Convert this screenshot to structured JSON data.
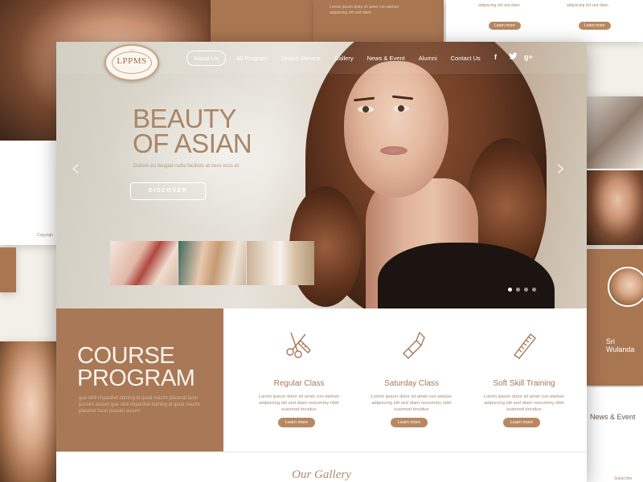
{
  "colors": {
    "accent": "#a97856",
    "button": "#b88862",
    "text_brown": "#a4795a"
  },
  "logo": {
    "text": "LPPMS"
  },
  "nav": {
    "items": [
      "About Us",
      "All Program",
      "Online Service",
      "Gallery",
      "News & Event",
      "Alumni",
      "Contact Us"
    ],
    "active": "About Us",
    "social": [
      "facebook-icon",
      "twitter-icon",
      "google-plus-icon"
    ]
  },
  "hero": {
    "title_line1": "BEAUTY",
    "title_line2": "OF ASIAN",
    "subtitle": "Dolore eu feugiat nulla facilisis at vero eros et",
    "cta": "DISCOVER",
    "slide_count": 4,
    "active_slide": 1
  },
  "course": {
    "title_line1": "COURSE",
    "title_line2": "PROGRAM",
    "description": "gue nihil imperdiet doming id quod mazim placerat facer possim assum gue nihil imperdiet doming id quod mazim placerat facer possim assum"
  },
  "classes": [
    {
      "title": "Regular Class",
      "text": "Lorem ipsum dolor sit amet con-stetuer adipiscing elit sed diam nonummy nibh euismod tincidun",
      "button": "Learn more",
      "icon": "scissors-comb-icon"
    },
    {
      "title": "Saturday Class",
      "text": "Lorem ipsum dolor sit amet con-stetuer adipiscing elit sed diam nonummy nibh euismod tincidun",
      "button": "Learn more",
      "icon": "lipstick-icon"
    },
    {
      "title": "Soft Skill Training",
      "text": "Lorem ipsum dolor sit amet con-stetuer adipiscing elit sed diam nonummy nibh euismod tincidun",
      "button": "Learn more",
      "icon": "comb-icon"
    }
  ],
  "gallery": {
    "title": "Our Gallery"
  },
  "background": {
    "right_name": "Sri Wulanda",
    "right_section": "News & Event",
    "learn_more": "Learn more",
    "copyright": "Copyrigh",
    "subscribe": "Subscribe"
  }
}
